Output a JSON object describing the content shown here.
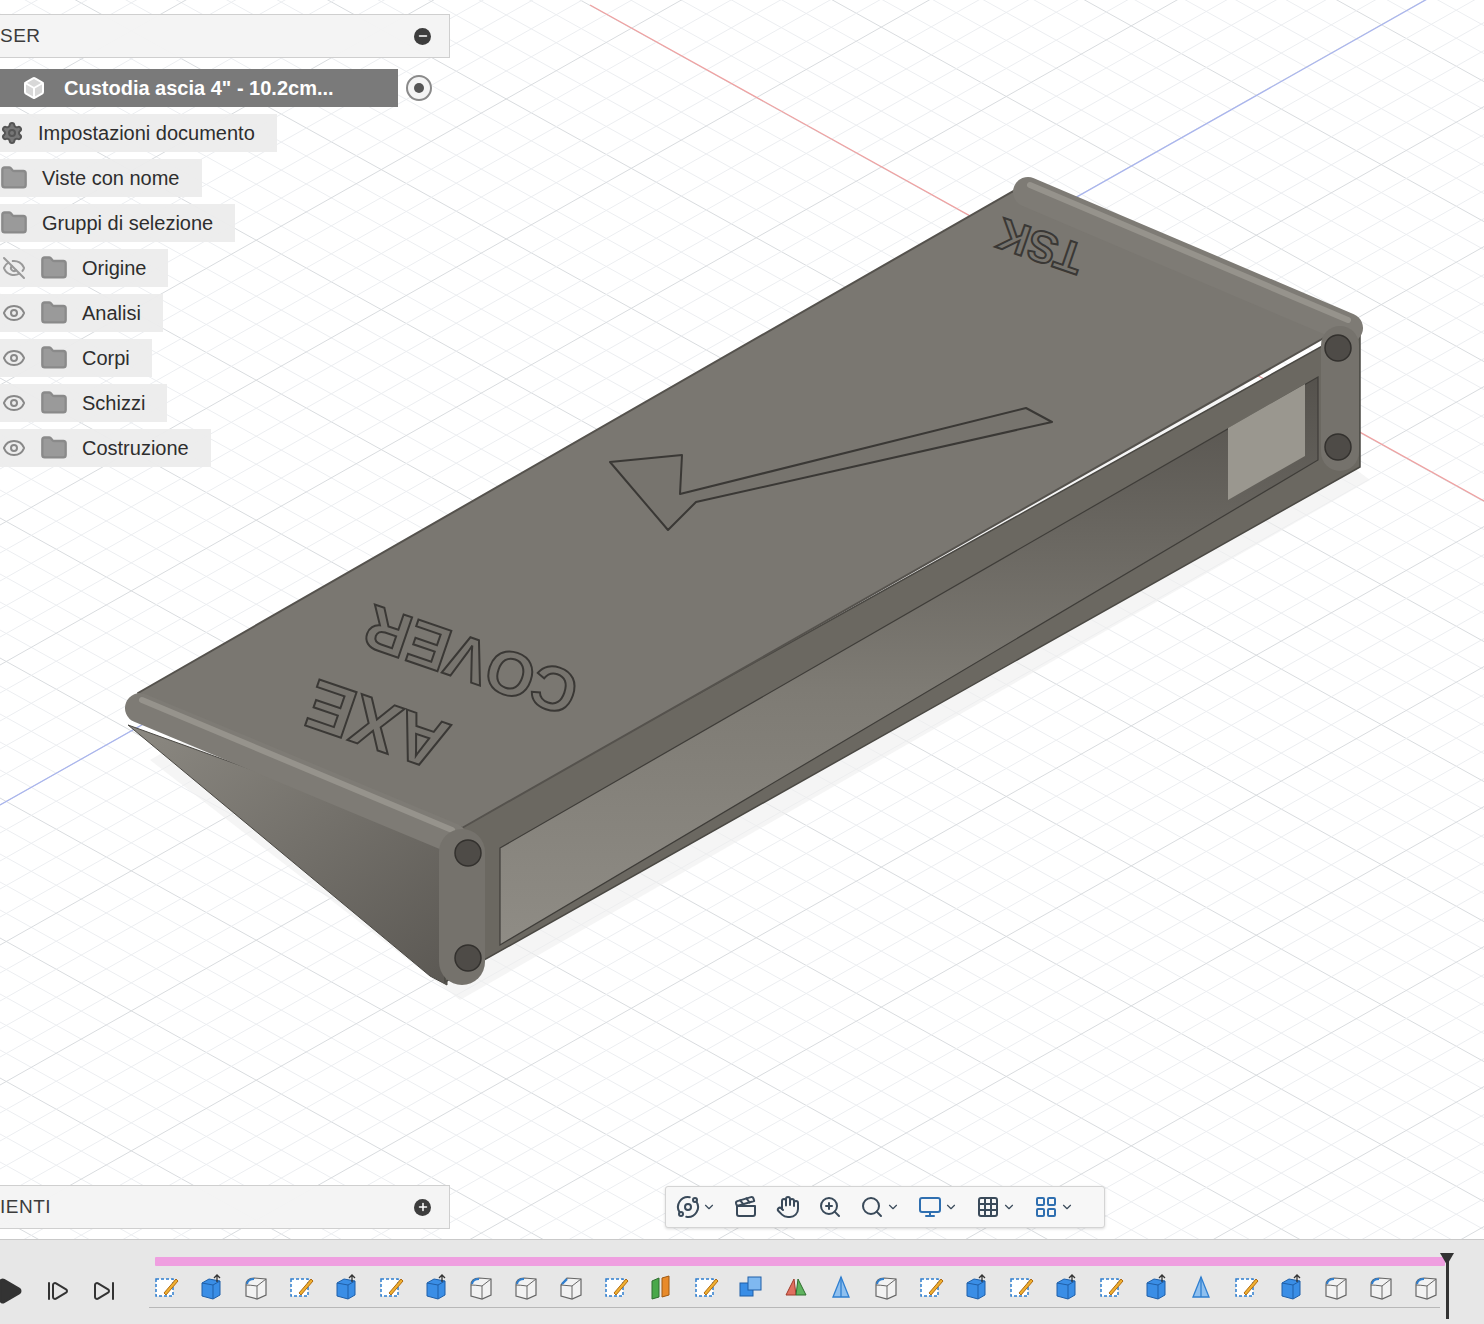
{
  "browser": {
    "title": "SER",
    "items": [
      {
        "label": "Custodia ascia 4\" - 10.2cm...",
        "kind": "document",
        "selected": true
      },
      {
        "label": "Impostazioni documento",
        "kind": "settings",
        "selected": false
      },
      {
        "label": "Viste con nome",
        "kind": "folder",
        "selected": false
      },
      {
        "label": "Gruppi di selezione",
        "kind": "folder",
        "selected": false
      },
      {
        "label": "Origine",
        "kind": "folder-eye",
        "selected": false,
        "visible": false
      },
      {
        "label": "Analisi",
        "kind": "folder-eye",
        "selected": false,
        "visible": true
      },
      {
        "label": "Corpi",
        "kind": "folder-eye",
        "selected": false,
        "visible": true
      },
      {
        "label": "Schizzi",
        "kind": "folder-eye",
        "selected": false,
        "visible": true
      },
      {
        "label": "Costruzione",
        "kind": "folder-eye",
        "selected": false,
        "visible": true
      }
    ]
  },
  "comments": {
    "title": "IENTI"
  },
  "model": {
    "line1": "AXE",
    "line2": "COVER",
    "mark": "TSK"
  },
  "timeline": {
    "features": [
      {
        "kind": "sketch"
      },
      {
        "kind": "extrude"
      },
      {
        "kind": "fillet"
      },
      {
        "kind": "sketch"
      },
      {
        "kind": "extrude"
      },
      {
        "kind": "sketch"
      },
      {
        "kind": "extrude"
      },
      {
        "kind": "fillet"
      },
      {
        "kind": "fillet"
      },
      {
        "kind": "chamfer"
      },
      {
        "kind": "sketch"
      },
      {
        "kind": "split"
      },
      {
        "kind": "sketch"
      },
      {
        "kind": "combine"
      },
      {
        "kind": "move"
      },
      {
        "kind": "mirror"
      },
      {
        "kind": "fillet"
      },
      {
        "kind": "sketch"
      },
      {
        "kind": "extrude"
      },
      {
        "kind": "sketch"
      },
      {
        "kind": "extrude"
      },
      {
        "kind": "sketch"
      },
      {
        "kind": "extrude"
      },
      {
        "kind": "mirror"
      },
      {
        "kind": "sketch"
      },
      {
        "kind": "extrude"
      },
      {
        "kind": "fillet"
      },
      {
        "kind": "fillet"
      },
      {
        "kind": "fillet"
      }
    ]
  }
}
